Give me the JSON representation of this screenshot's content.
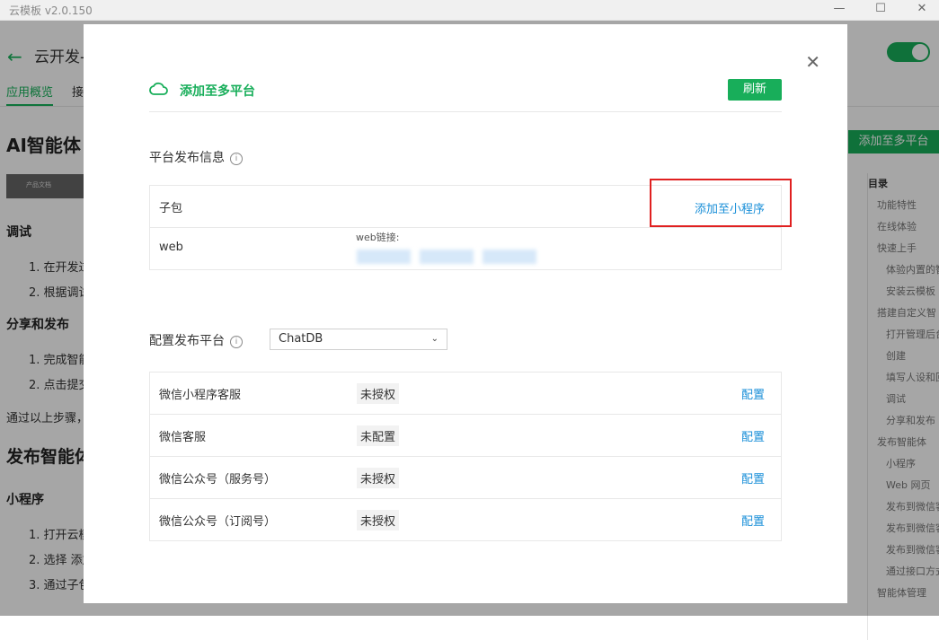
{
  "window": {
    "title": "云模板 v2.0.150",
    "min": "—",
    "max": "☐",
    "close": "✕"
  },
  "background": {
    "back_icon": "←",
    "header_title": "云开发-",
    "tabs": [
      "应用概览",
      "接"
    ],
    "h1": "AI智能体",
    "img_label": "产品文档",
    "debug": "调试",
    "debug_items": [
      "1. 在开发过",
      "2. 根据调试"
    ],
    "share": "分享和发布",
    "share_items": [
      "1. 完成智能",
      "2. 点击提交"
    ],
    "summary": "通过以上步骤，",
    "publish_h2": "发布智能体",
    "mini": "小程序",
    "mini_items": [
      "1. 打开云模",
      "2. 选择 添加",
      "3. 通过子包"
    ],
    "add_platform_btn": "添加至多平台",
    "toc": [
      "目录",
      "功能特性",
      "在线体验",
      "快速上手",
      "体验内置的智",
      "安装云模板",
      "搭建自定义智",
      "打开管理后台",
      "创建",
      "填写人设和回",
      "调试",
      "分享和发布",
      "发布智能体",
      "小程序",
      "Web 网页",
      "发布到微信客",
      "发布到微信客",
      "发布到微信客",
      "通过接口方式",
      "智能体管理"
    ]
  },
  "modal": {
    "close": "✕",
    "title": "添加至多平台",
    "refresh": "刷新",
    "publish_info_title": "平台发布信息",
    "info_icon": "i",
    "rows": [
      {
        "name": "子包",
        "action": "添加至小程序"
      },
      {
        "name": "web",
        "link_label": "web链接:"
      }
    ],
    "config_title": "配置发布平台",
    "platform_select": "ChatDB",
    "chevron": "⌄",
    "platforms": [
      {
        "name": "微信小程序客服",
        "status": "未授权",
        "action": "配置"
      },
      {
        "name": "微信客服",
        "status": "未配置",
        "action": "配置"
      },
      {
        "name": "微信公众号（服务号）",
        "status": "未授权",
        "action": "配置"
      },
      {
        "name": "微信公众号（订阅号）",
        "status": "未授权",
        "action": "配置"
      }
    ]
  }
}
